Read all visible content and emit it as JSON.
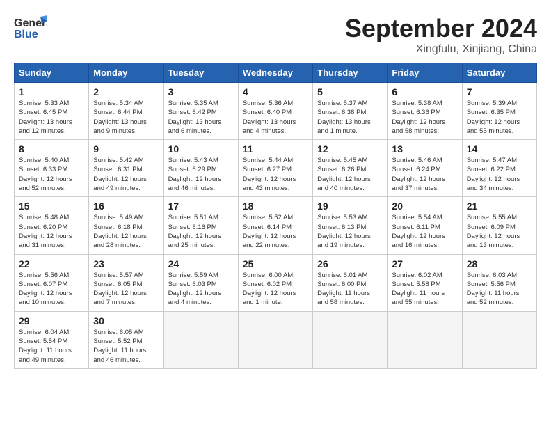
{
  "header": {
    "logo_line1": "General",
    "logo_line2": "Blue",
    "month": "September 2024",
    "location": "Xingfulu, Xinjiang, China"
  },
  "weekdays": [
    "Sunday",
    "Monday",
    "Tuesday",
    "Wednesday",
    "Thursday",
    "Friday",
    "Saturday"
  ],
  "weeks": [
    [
      {
        "day": "1",
        "info": "Sunrise: 5:33 AM\nSunset: 6:45 PM\nDaylight: 13 hours\nand 12 minutes."
      },
      {
        "day": "2",
        "info": "Sunrise: 5:34 AM\nSunset: 6:44 PM\nDaylight: 13 hours\nand 9 minutes."
      },
      {
        "day": "3",
        "info": "Sunrise: 5:35 AM\nSunset: 6:42 PM\nDaylight: 13 hours\nand 6 minutes."
      },
      {
        "day": "4",
        "info": "Sunrise: 5:36 AM\nSunset: 6:40 PM\nDaylight: 13 hours\nand 4 minutes."
      },
      {
        "day": "5",
        "info": "Sunrise: 5:37 AM\nSunset: 6:38 PM\nDaylight: 13 hours\nand 1 minute."
      },
      {
        "day": "6",
        "info": "Sunrise: 5:38 AM\nSunset: 6:36 PM\nDaylight: 12 hours\nand 58 minutes."
      },
      {
        "day": "7",
        "info": "Sunrise: 5:39 AM\nSunset: 6:35 PM\nDaylight: 12 hours\nand 55 minutes."
      }
    ],
    [
      {
        "day": "8",
        "info": "Sunrise: 5:40 AM\nSunset: 6:33 PM\nDaylight: 12 hours\nand 52 minutes."
      },
      {
        "day": "9",
        "info": "Sunrise: 5:42 AM\nSunset: 6:31 PM\nDaylight: 12 hours\nand 49 minutes."
      },
      {
        "day": "10",
        "info": "Sunrise: 5:43 AM\nSunset: 6:29 PM\nDaylight: 12 hours\nand 46 minutes."
      },
      {
        "day": "11",
        "info": "Sunrise: 5:44 AM\nSunset: 6:27 PM\nDaylight: 12 hours\nand 43 minutes."
      },
      {
        "day": "12",
        "info": "Sunrise: 5:45 AM\nSunset: 6:26 PM\nDaylight: 12 hours\nand 40 minutes."
      },
      {
        "day": "13",
        "info": "Sunrise: 5:46 AM\nSunset: 6:24 PM\nDaylight: 12 hours\nand 37 minutes."
      },
      {
        "day": "14",
        "info": "Sunrise: 5:47 AM\nSunset: 6:22 PM\nDaylight: 12 hours\nand 34 minutes."
      }
    ],
    [
      {
        "day": "15",
        "info": "Sunrise: 5:48 AM\nSunset: 6:20 PM\nDaylight: 12 hours\nand 31 minutes."
      },
      {
        "day": "16",
        "info": "Sunrise: 5:49 AM\nSunset: 6:18 PM\nDaylight: 12 hours\nand 28 minutes."
      },
      {
        "day": "17",
        "info": "Sunrise: 5:51 AM\nSunset: 6:16 PM\nDaylight: 12 hours\nand 25 minutes."
      },
      {
        "day": "18",
        "info": "Sunrise: 5:52 AM\nSunset: 6:14 PM\nDaylight: 12 hours\nand 22 minutes."
      },
      {
        "day": "19",
        "info": "Sunrise: 5:53 AM\nSunset: 6:13 PM\nDaylight: 12 hours\nand 19 minutes."
      },
      {
        "day": "20",
        "info": "Sunrise: 5:54 AM\nSunset: 6:11 PM\nDaylight: 12 hours\nand 16 minutes."
      },
      {
        "day": "21",
        "info": "Sunrise: 5:55 AM\nSunset: 6:09 PM\nDaylight: 12 hours\nand 13 minutes."
      }
    ],
    [
      {
        "day": "22",
        "info": "Sunrise: 5:56 AM\nSunset: 6:07 PM\nDaylight: 12 hours\nand 10 minutes."
      },
      {
        "day": "23",
        "info": "Sunrise: 5:57 AM\nSunset: 6:05 PM\nDaylight: 12 hours\nand 7 minutes."
      },
      {
        "day": "24",
        "info": "Sunrise: 5:59 AM\nSunset: 6:03 PM\nDaylight: 12 hours\nand 4 minutes."
      },
      {
        "day": "25",
        "info": "Sunrise: 6:00 AM\nSunset: 6:02 PM\nDaylight: 12 hours\nand 1 minute."
      },
      {
        "day": "26",
        "info": "Sunrise: 6:01 AM\nSunset: 6:00 PM\nDaylight: 11 hours\nand 58 minutes."
      },
      {
        "day": "27",
        "info": "Sunrise: 6:02 AM\nSunset: 5:58 PM\nDaylight: 11 hours\nand 55 minutes."
      },
      {
        "day": "28",
        "info": "Sunrise: 6:03 AM\nSunset: 5:56 PM\nDaylight: 11 hours\nand 52 minutes."
      }
    ],
    [
      {
        "day": "29",
        "info": "Sunrise: 6:04 AM\nSunset: 5:54 PM\nDaylight: 11 hours\nand 49 minutes."
      },
      {
        "day": "30",
        "info": "Sunrise: 6:05 AM\nSunset: 5:52 PM\nDaylight: 11 hours\nand 46 minutes."
      },
      null,
      null,
      null,
      null,
      null
    ]
  ]
}
